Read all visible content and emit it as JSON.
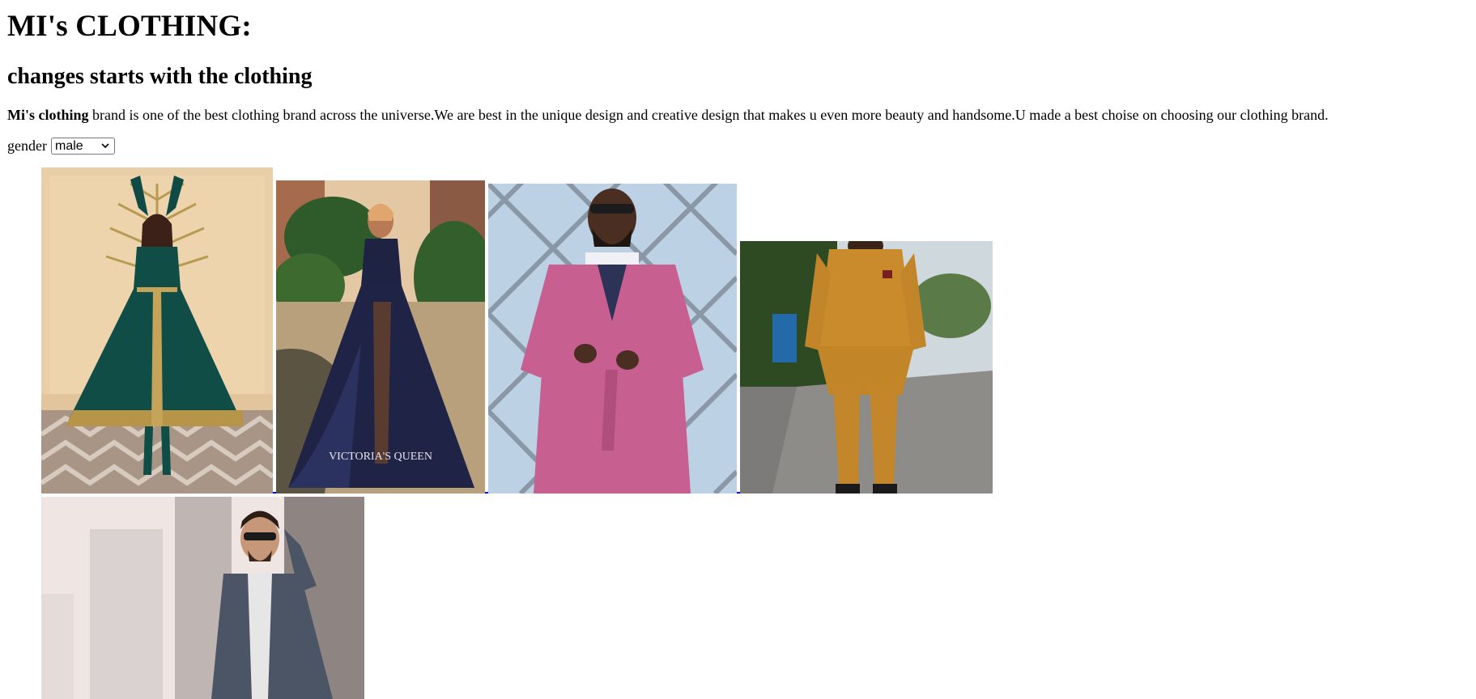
{
  "header": {
    "title": "MI's CLOTHING:",
    "tagline": "changes starts with the clothing"
  },
  "description": {
    "brand_bold": "Mi's clothing",
    "text": " brand is one of the best clothing brand across the universe.We are best in the unique design and creative design that makes u even more beauty and handsome.U made a best choise on choosing our clothing brand."
  },
  "filter": {
    "label": "gender",
    "selected": "male"
  },
  "gallery": {
    "photos": [
      {
        "subject": "woman in green embroidered gown",
        "watermark": ""
      },
      {
        "subject": "woman in navy satin jumpsuit gown",
        "watermark": "VICTORIA'S QUEEN"
      },
      {
        "subject": "man in pink double-breasted suit",
        "watermark": ""
      },
      {
        "subject": "man in mustard traditional suit",
        "watermark": ""
      },
      {
        "subject": "man in denim jacket with sunglasses",
        "watermark": ""
      }
    ]
  },
  "colors": {
    "text": "#000000",
    "link": "#0000ee",
    "background": "#ffffff"
  }
}
